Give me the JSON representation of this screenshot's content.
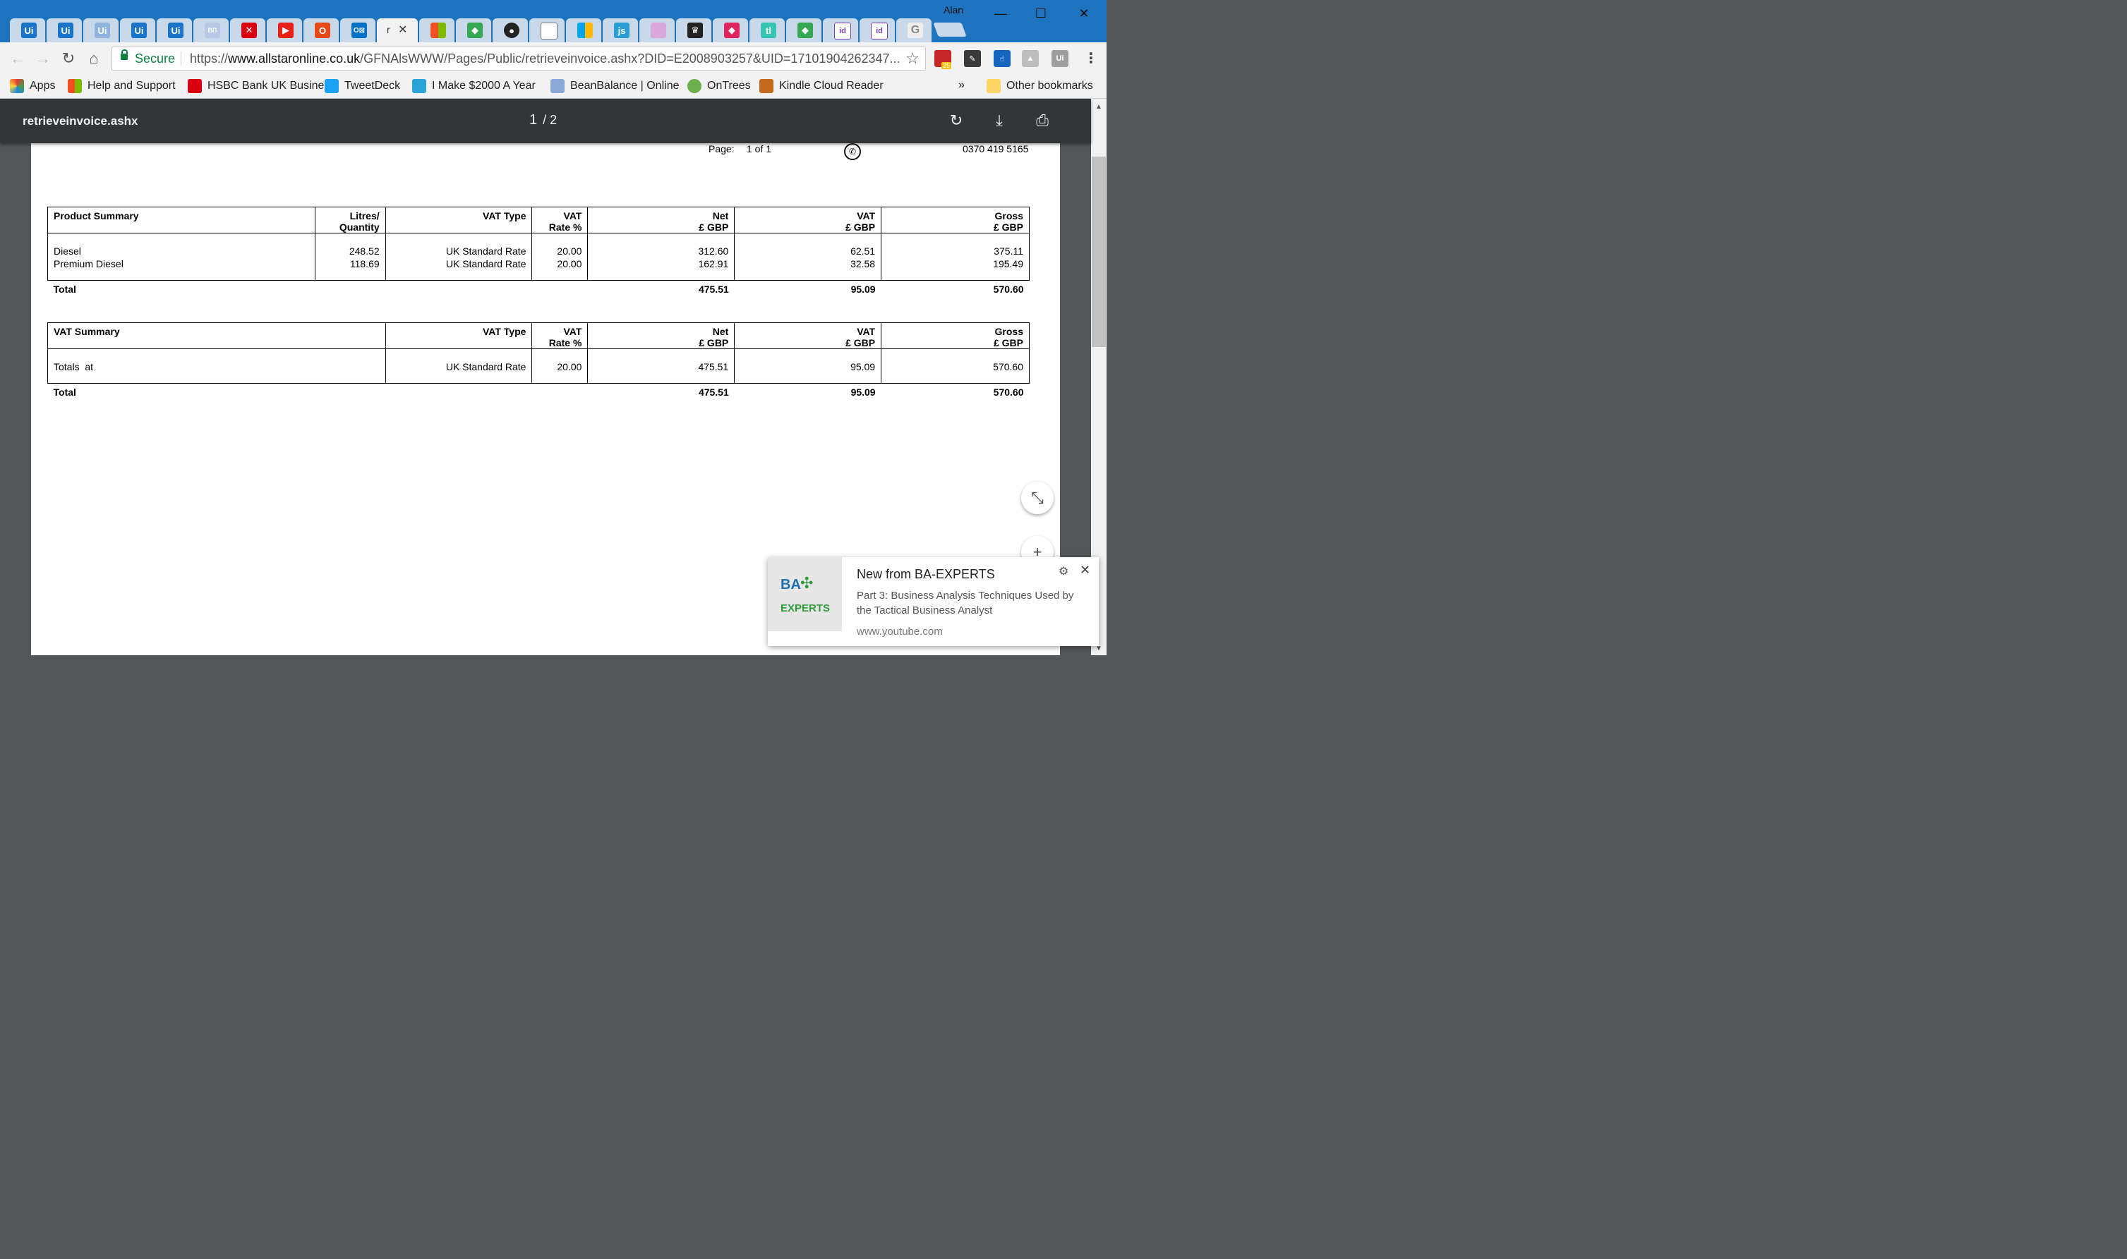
{
  "browser": {
    "profile_name": "Alan",
    "active_tab_label": "r",
    "address": {
      "secure_label": "Secure",
      "url_scheme": "https://",
      "url_domain": "www.allstaronline.co.uk",
      "url_path": "/GFNAlsWWW/Pages/Public/retrieveinvoice.ashx?DID=E2008903257&UID=17101904262347..."
    },
    "extension_badge": "25",
    "bookmarks": [
      {
        "label": "Apps",
        "icon": "apps-grid-icon",
        "color": "#e53935"
      },
      {
        "label": "Help and Support",
        "icon": "microsoft-icon",
        "color": "#f25022"
      },
      {
        "label": "HSBC Bank UK Busine",
        "icon": "hsbc-icon",
        "color": "#db0011"
      },
      {
        "label": "TweetDeck",
        "icon": "tweetdeck-icon",
        "color": "#1da1f2"
      },
      {
        "label": "I Make $2000 A Year",
        "icon": "m-icon",
        "color": "#29a3d8"
      },
      {
        "label": "BeanBalance | Online",
        "icon": "beanbalance-icon",
        "color": "#8aa9d6"
      },
      {
        "label": "OnTrees",
        "icon": "ontrees-icon",
        "color": "#6ab04c"
      },
      {
        "label": "Kindle Cloud Reader",
        "icon": "kindle-icon",
        "color": "#c46a1c"
      }
    ],
    "bookmarks_more": "»",
    "other_bookmarks": "Other bookmarks"
  },
  "pdf_viewer": {
    "title": "retrieveinvoice.ashx",
    "current_page": "1",
    "page_total": "/ 2"
  },
  "invoice": {
    "page_label": "Page:",
    "page_value": "1 of 1",
    "phone_number": "0370 419 5165",
    "product_summary": {
      "headers": {
        "product": "Product Summary",
        "litres_line1": "Litres/",
        "litres_line2": "Quantity",
        "vat_type": "VAT Type",
        "vat_rate_line1": "VAT",
        "vat_rate_line2": "Rate %",
        "net_line1": "Net",
        "net_line2": "£ GBP",
        "vat_line1": "VAT",
        "vat_line2": "£ GBP",
        "gross_line1": "Gross",
        "gross_line2": "£ GBP"
      },
      "rows": [
        {
          "product": "Diesel",
          "litres": "248.52",
          "vat_type": "UK Standard Rate",
          "vat_rate": "20.00",
          "net": "312.60",
          "vat": "62.51",
          "gross": "375.11"
        },
        {
          "product": "Premium Diesel",
          "litres": "118.69",
          "vat_type": "UK Standard Rate",
          "vat_rate": "20.00",
          "net": "162.91",
          "vat": "32.58",
          "gross": "195.49"
        }
      ],
      "total": {
        "label": "Total",
        "net": "475.51",
        "vat": "95.09",
        "gross": "570.60"
      }
    },
    "vat_summary": {
      "headers": {
        "summary": "VAT Summary",
        "vat_type": "VAT Type",
        "vat_rate_line1": "VAT",
        "vat_rate_line2": "Rate %",
        "net_line1": "Net",
        "net_line2": "£ GBP",
        "vat_line1": "VAT",
        "vat_line2": "£ GBP",
        "gross_line1": "Gross",
        "gross_line2": "£ GBP"
      },
      "row": {
        "label": "Totals  at",
        "vat_type": "UK Standard Rate",
        "vat_rate": "20.00",
        "net": "475.51",
        "vat": "95.09",
        "gross": "570.60"
      },
      "total": {
        "label": "Total",
        "net": "475.51",
        "vat": "95.09",
        "gross": "570.60"
      }
    }
  },
  "notification": {
    "logo_top": "BA",
    "logo_bottom": "EXPERTS",
    "title": "New from BA-EXPERTS",
    "body": "Part 3: Business Analysis Techniques Used by the Tactical Business Analyst",
    "source": "www.youtube.com"
  }
}
